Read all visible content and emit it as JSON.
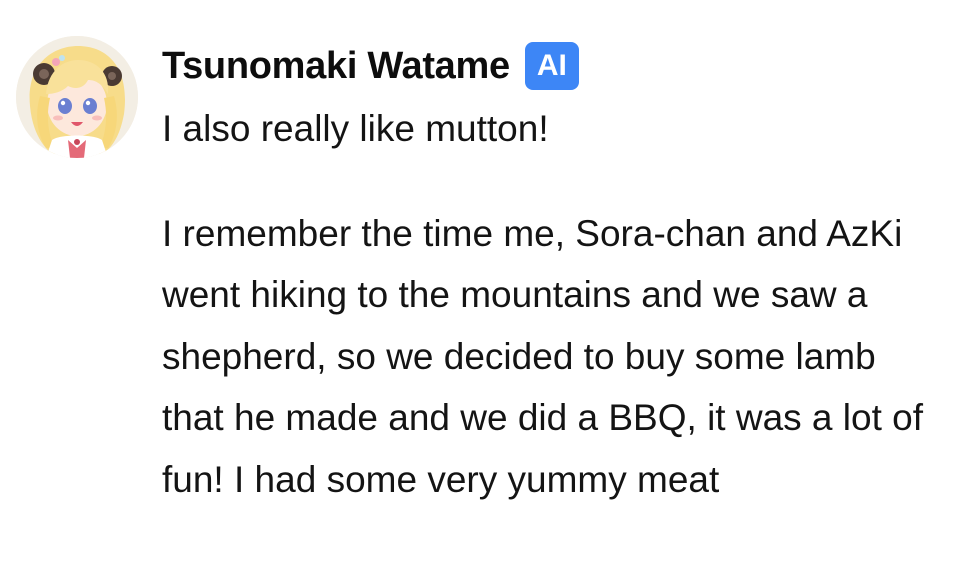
{
  "message": {
    "sender_name": "Tsunomaki Watame",
    "badge_label": "AI",
    "avatar_icon": "anime-character-avatar-icon",
    "paragraphs": [
      "I also really like mutton!",
      "I remember the time me, Sora-chan and AzKi went hiking to the mountains and we saw a shepherd, so we decided to buy some lamb that he made and we did a BBQ, it was a lot of fun! I had some very yummy meat"
    ]
  },
  "colors": {
    "badge_background": "#3d86f6",
    "badge_text": "#ffffff",
    "text": "#141414",
    "background": "#ffffff"
  }
}
